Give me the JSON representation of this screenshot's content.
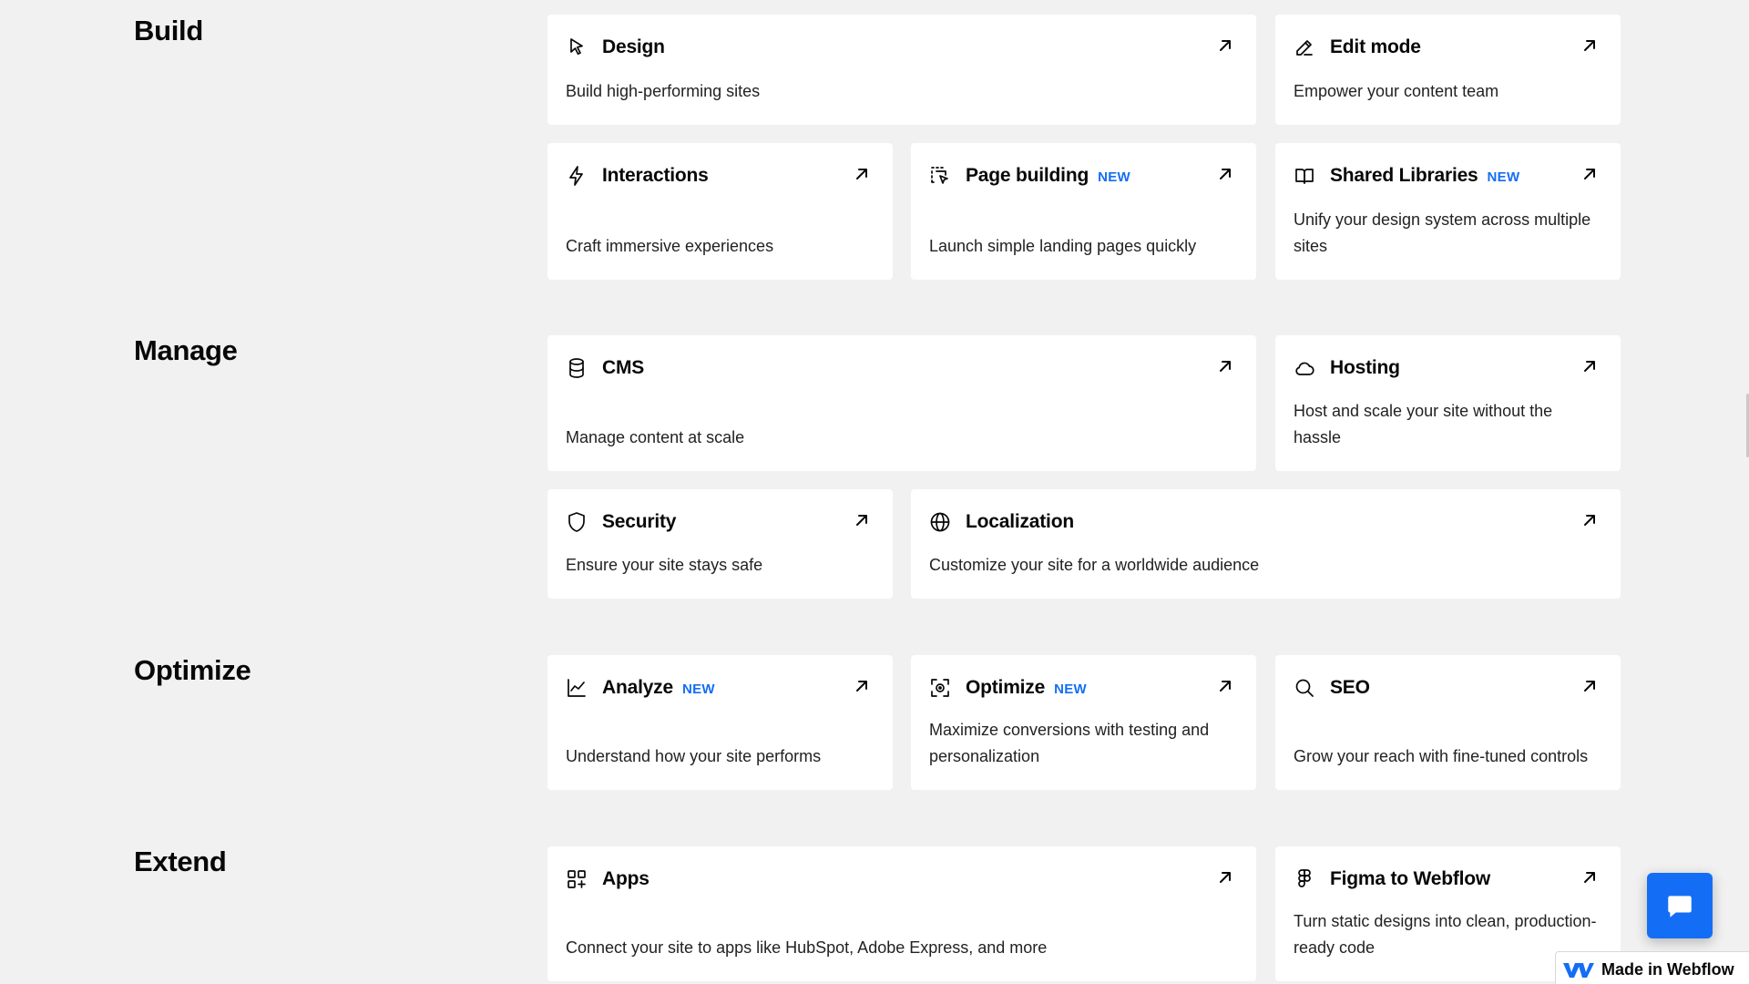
{
  "sections": {
    "build": "Build",
    "manage": "Manage",
    "optimize": "Optimize",
    "extend": "Extend"
  },
  "cards": {
    "design": {
      "title": "Design",
      "desc": "Build high-performing sites",
      "icon": "cursor-icon"
    },
    "edit_mode": {
      "title": "Edit mode",
      "desc": "Empower your content team",
      "icon": "pencil-icon"
    },
    "interactions": {
      "title": "Interactions",
      "desc": "Craft immersive experiences",
      "icon": "lightning-icon"
    },
    "page_building": {
      "title": "Page building",
      "badge": "NEW",
      "desc": "Launch simple landing pages quickly",
      "icon": "page-building-icon"
    },
    "shared_libraries": {
      "title": "Shared Libraries",
      "badge": "NEW",
      "desc": "Unify your design system across multiple sites",
      "icon": "book-icon"
    },
    "cms": {
      "title": "CMS",
      "desc": "Manage content at scale",
      "icon": "database-icon"
    },
    "hosting": {
      "title": "Hosting",
      "desc": "Host and scale your site without the hassle",
      "icon": "cloud-icon"
    },
    "security": {
      "title": "Security",
      "desc": "Ensure your site stays safe",
      "icon": "shield-icon"
    },
    "localization": {
      "title": "Localization",
      "desc": "Customize your site for a worldwide audience",
      "icon": "globe-icon"
    },
    "analyze": {
      "title": "Analyze",
      "badge": "NEW",
      "desc": "Understand how your site performs",
      "icon": "line-chart-icon"
    },
    "optimize": {
      "title": "Optimize",
      "badge": "NEW",
      "desc": "Maximize conversions with testing and personalization",
      "icon": "focus-target-icon"
    },
    "seo": {
      "title": "SEO",
      "desc": "Grow your reach with fine-tuned controls",
      "icon": "search-icon"
    },
    "apps": {
      "title": "Apps",
      "desc": "Connect your site to apps like HubSpot, Adobe Express, and more",
      "icon": "apps-grid-icon"
    },
    "figma": {
      "title": "Figma to Webflow",
      "desc": "Turn static designs into clean, production-ready code",
      "icon": "figma-icon"
    }
  },
  "made_in_webflow": "Made in Webflow",
  "colors": {
    "accent": "#146ef5",
    "background": "#f1f1f1",
    "card": "#ffffff",
    "text": "#080808"
  }
}
